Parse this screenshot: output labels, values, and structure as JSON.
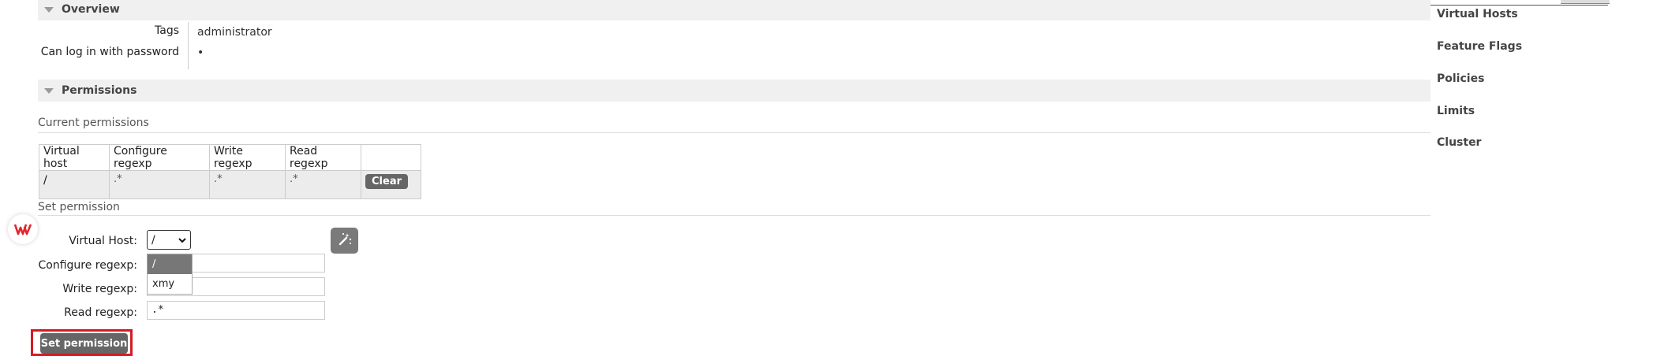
{
  "overview": {
    "title": "Overview",
    "tags_label": "Tags",
    "tags_value": "administrator",
    "password_label": "Can log in with password",
    "password_value": "•"
  },
  "permissions": {
    "title": "Permissions",
    "current_title": "Current permissions",
    "table": {
      "headers": [
        "Virtual host",
        "Configure regexp",
        "Write regexp",
        "Read regexp",
        ""
      ],
      "rows": [
        {
          "vhost": "/",
          "configure": ".*",
          "write": ".*",
          "read": ".*",
          "action": "Clear"
        }
      ]
    },
    "set_title": "Set permission",
    "form": {
      "vhost_label": "Virtual Host:",
      "vhost_selected": "/",
      "vhost_options": [
        "/",
        "xmy"
      ],
      "configure_label": "Configure regexp:",
      "configure_value": "",
      "write_label": "Write regexp:",
      "write_value": "",
      "read_label": "Read regexp:",
      "read_value": ".*",
      "submit_label": "Set permission"
    }
  },
  "sidebar": {
    "items": [
      "Virtual Hosts",
      "Feature Flags",
      "Policies",
      "Limits",
      "Cluster"
    ]
  },
  "icons": {
    "collapse": "triangle-down-icon",
    "wand": "magic-wand-icon",
    "wps": "wps-logo-icon"
  },
  "colors": {
    "highlight_border": "#d31a25",
    "button_bg": "#666666",
    "section_bg": "#f0f0f0"
  }
}
